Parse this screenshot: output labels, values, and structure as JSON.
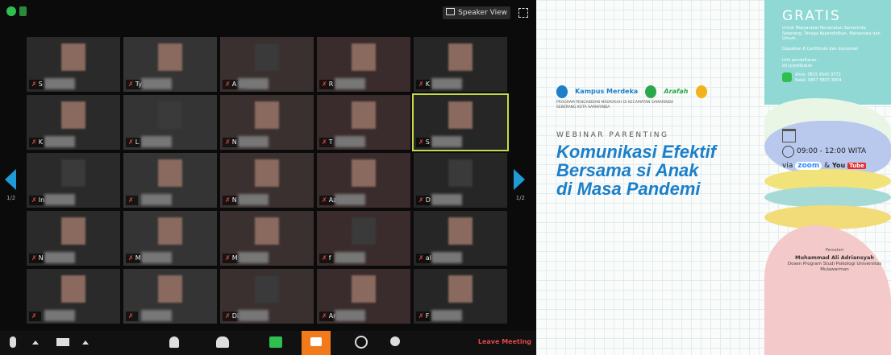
{
  "zoom": {
    "speaker_view_label": "Speaker View",
    "page_left": "1/2",
    "page_right": "1/2",
    "leave_label": "Leave Meeting",
    "tiles": [
      {
        "name": "S"
      },
      {
        "name": "Ty"
      },
      {
        "name": "A  M"
      },
      {
        "name": "R"
      },
      {
        "name": "K"
      },
      {
        "name": "K"
      },
      {
        "name": "L"
      },
      {
        "name": "N"
      },
      {
        "name": "T"
      },
      {
        "name": "S"
      },
      {
        "name": "In"
      },
      {
        "name": ""
      },
      {
        "name": "N"
      },
      {
        "name": "Az"
      },
      {
        "name": "D"
      },
      {
        "name": "N"
      },
      {
        "name": "M"
      },
      {
        "name": "M"
      },
      {
        "name": "f"
      },
      {
        "name": "al"
      },
      {
        "name": ""
      },
      {
        "name": ""
      },
      {
        "name": "Di"
      },
      {
        "name": "Ar"
      },
      {
        "name": "F"
      }
    ]
  },
  "poster": {
    "logo1": "Kampus Merdeka",
    "logo2": "Arafah",
    "org_text": "PROGRAM PENGABDIAN MADRASAH DI KECAMATAN SAMARINDA SEBERANG KOTA SAMARINDA",
    "webinar_label": "WEBINAR PARENTING",
    "headline_1": "Komunikasi Efektif",
    "headline_2": "Bersama si Anak",
    "headline_3": "di Masa Pandemi",
    "gratis": "GRATIS",
    "untuk": "Untuk Masyarakat Kecamatan Samarinda Seberang, Tenaga Kependidikan, Mahasiswa dan Umum",
    "certificate": "Dapatkan E-Certificate dan doorprize!",
    "reg_label": "Link pendaftaran:",
    "reg_link": "bit.ly/pelibatan",
    "contact1": "Alvia: 0815 4541 9772",
    "contact2": "Nabil: 0857 5807 3004",
    "time": "09:00 - 12:00 WITA",
    "via": "via",
    "zoom": "zoom",
    "amp": "&",
    "you": "You",
    "tube": "Tube",
    "speaker_label": "Pemateri",
    "speaker_name": "Muhammad Ali Adriansyah",
    "speaker_role": "Dosen Program Studi Psikologi Universitas Mulawarman"
  }
}
